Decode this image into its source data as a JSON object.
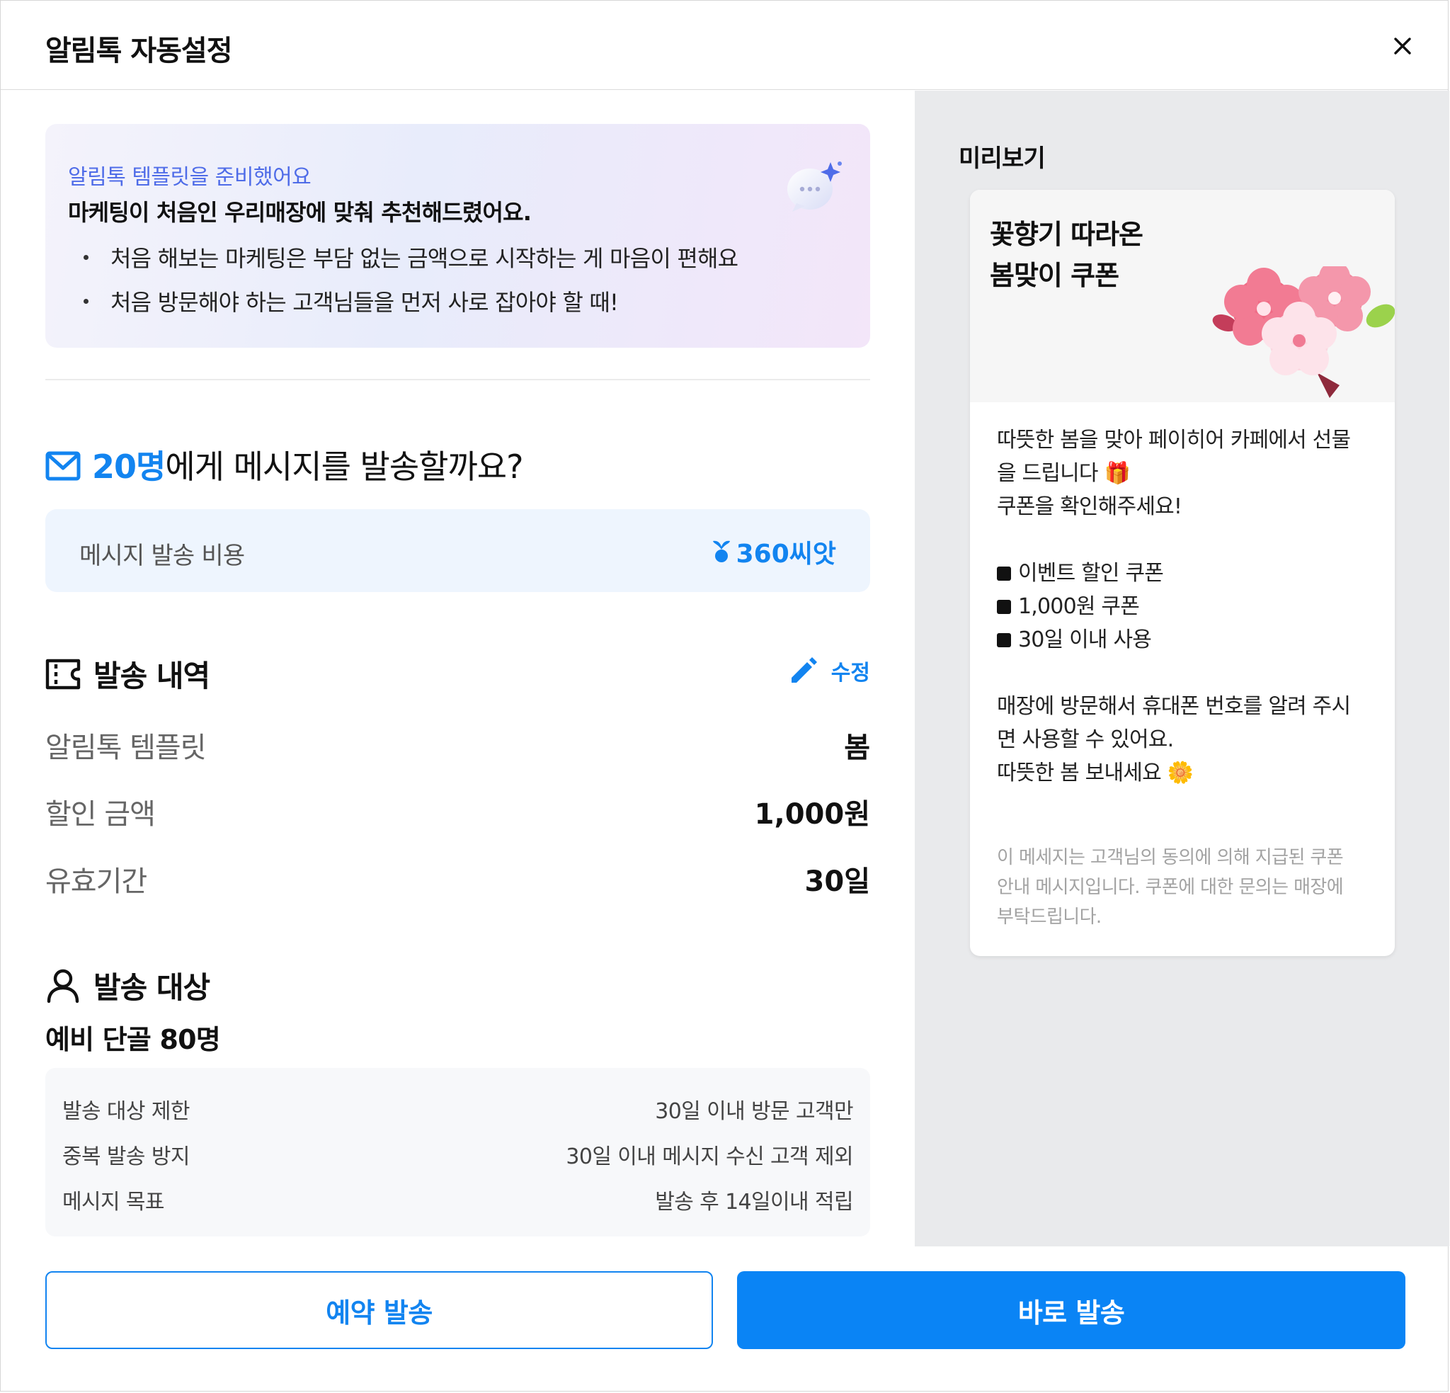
{
  "header": {
    "title": "알림톡 자동설정"
  },
  "banner": {
    "subtitle": "알림톡 템플릿을 준비했어요",
    "title": "마케팅이 처음인 우리매장에 맞춰 추천해드렸어요.",
    "bullets": [
      "처음 해보는 마케팅은 부담 없는 금액으로 시작하는 게 마음이 편해요",
      "처음 방문해야 하는 고객님들을 먼저 사로 잡아야 할 때!"
    ]
  },
  "send": {
    "count": "20명",
    "question_suffix": "에게 메시지를 발송할까요?"
  },
  "cost": {
    "label": "메시지 발송 비용",
    "value": "360씨앗"
  },
  "details": {
    "title": "발송 내역",
    "edit_label": "수정",
    "rows": [
      {
        "key": "알림톡 템플릿",
        "value": "봄"
      },
      {
        "key": "할인 금액",
        "value": "1,000원"
      },
      {
        "key": "유효기간",
        "value": "30일"
      }
    ]
  },
  "target": {
    "title": "발송 대상",
    "name": "예비 단골 80명",
    "conditions": [
      {
        "key": "발송 대상 제한",
        "value": "30일 이내 방문 고객만"
      },
      {
        "key": "중복 발송 방지",
        "value": "30일 이내 메시지 수신 고객 제외"
      },
      {
        "key": "메시지 목표",
        "value": "발송 후 14일이내 적립"
      }
    ]
  },
  "preview": {
    "label": "미리보기",
    "card_title_1": "꽃향기 따라온",
    "card_title_2": "봄맞이 쿠폰",
    "body_1": "따뜻한 봄을 맞아 페이히어 카페에서 선물",
    "body_2": "을 드립니다 🎁",
    "body_3": "쿠폰을 확인해주세요!",
    "items": [
      "이벤트 할인 쿠폰",
      "1,000원 쿠폰",
      "30일 이내 사용"
    ],
    "body_4": "매장에 방문해서 휴대폰 번호를 알려 주시",
    "body_5": "면 사용할 수 있어요.",
    "body_6": "따뜻한 봄 보내세요 🌼",
    "footer_1": "이 메세지는 고객님의 동의에 의해 지급된 쿠폰",
    "footer_2": "안내 메시지입니다.  쿠폰에 대한 문의는 매장에",
    "footer_3": "부탁드립니다."
  },
  "buttons": {
    "reserve": "예약 발송",
    "send_now": "바로 발송"
  },
  "colors": {
    "accent": "#1284f0",
    "primary_button": "#0a84f5",
    "preview_bg": "#e9eaec"
  }
}
